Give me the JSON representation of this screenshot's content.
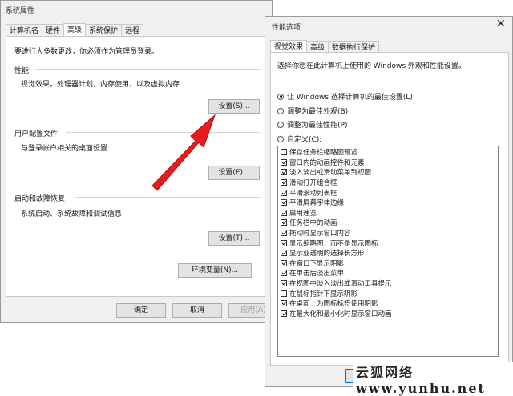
{
  "sysprops": {
    "title": "系统属性",
    "tabs": [
      "计算机名",
      "硬件",
      "高级",
      "系统保护",
      "远程"
    ],
    "notice": "要进行大多数更改，你必须作为管理员登录。",
    "performance": {
      "label": "性能",
      "desc": "视觉效果，处理器计划，内存使用，以及虚拟内存",
      "button": "设置(S)..."
    },
    "profiles": {
      "label": "用户配置文件",
      "desc": "与登录帐户相关的桌面设置",
      "button": "设置(E)..."
    },
    "startup": {
      "label": "启动和故障恢复",
      "desc": "系统启动、系统故障和调试信息",
      "button": "设置(T)..."
    },
    "env_button": "环境变量(N)...",
    "ok": "确定",
    "cancel": "取消",
    "apply": "应用(A)"
  },
  "perf": {
    "title": "性能选项",
    "tabs": [
      "视觉效果",
      "高级",
      "数据执行保护"
    ],
    "intro": "选择你想在此计算机上使用的 Windows 外观和性能设置。",
    "radios": [
      {
        "label": "让 Windows 选择计算机的最佳设置(L)",
        "selected": true
      },
      {
        "label": "调整为最佳外观(B)",
        "selected": false
      },
      {
        "label": "调整为最佳性能(P)",
        "selected": false
      },
      {
        "label": "自定义(C):",
        "selected": false
      }
    ],
    "options": [
      {
        "label": "保存任务栏缩略图预览",
        "checked": false
      },
      {
        "label": "窗口内的动画控件和元素",
        "checked": true
      },
      {
        "label": "淡入淡出或滑动菜单到视图",
        "checked": true
      },
      {
        "label": "滑动打开组合框",
        "checked": true
      },
      {
        "label": "平滑滚动列表框",
        "checked": true
      },
      {
        "label": "平滑屏幕字体边缘",
        "checked": true
      },
      {
        "label": "启用速览",
        "checked": true
      },
      {
        "label": "任务栏中的动画",
        "checked": true
      },
      {
        "label": "拖动时显示窗口内容",
        "checked": true
      },
      {
        "label": "显示缩略图，而不是显示图标",
        "checked": true
      },
      {
        "label": "显示亚透明的选择长方形",
        "checked": true
      },
      {
        "label": "在窗口下显示阴影",
        "checked": true
      },
      {
        "label": "在单击后淡出菜单",
        "checked": true
      },
      {
        "label": "在视图中淡入淡出或滑动工具提示",
        "checked": true
      },
      {
        "label": "在鼠标指针下显示阴影",
        "checked": false
      },
      {
        "label": "在桌面上为图标标签使用阴影",
        "checked": true
      },
      {
        "label": "在最大化和最小化时显示窗口动画",
        "checked": true
      }
    ]
  },
  "watermark": "云狐网络 www.yunhu.net",
  "colors": {
    "arrow": "#e81c1c",
    "dialog_bg": "#f0f0f0"
  }
}
